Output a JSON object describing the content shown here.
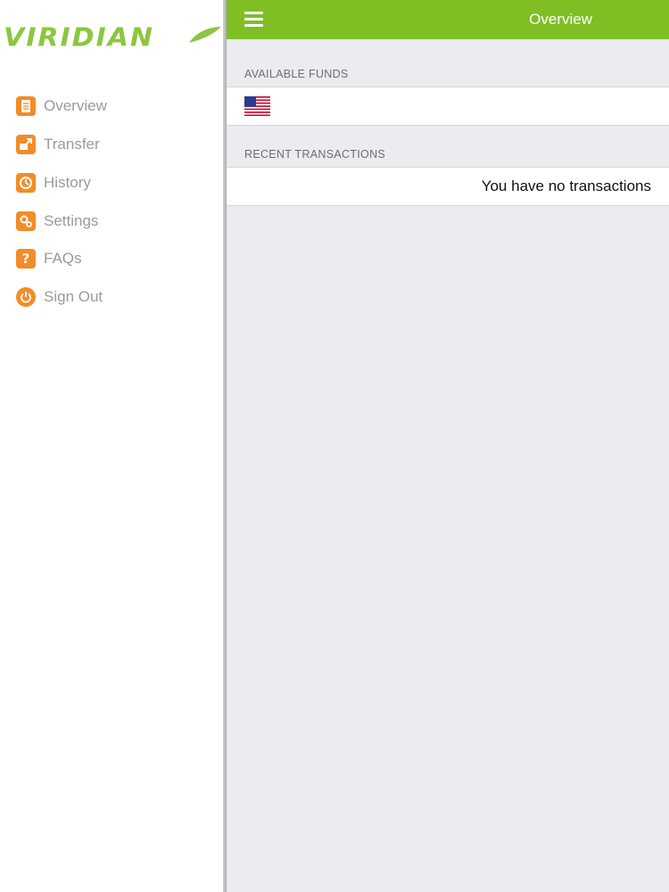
{
  "brand": {
    "logo_text": "VIRIDIAN",
    "accent_color": "#7fbf24",
    "icon_color": "#f28c28"
  },
  "sidebar": {
    "items": [
      {
        "label": "Overview",
        "icon": "document-icon"
      },
      {
        "label": "Transfer",
        "icon": "transfer-icon"
      },
      {
        "label": "History",
        "icon": "history-icon"
      },
      {
        "label": "Settings",
        "icon": "gear-icon"
      },
      {
        "label": "FAQs",
        "icon": "question-icon"
      },
      {
        "label": "Sign Out",
        "icon": "power-icon"
      }
    ]
  },
  "header": {
    "title": "Overview",
    "menu_icon": "hamburger-menu-icon"
  },
  "available_funds": {
    "label": "AVAILABLE FUNDS",
    "currency_icon": "us-flag-icon"
  },
  "recent_transactions": {
    "label": "RECENT TRANSACTIONS",
    "empty_message": "You have no transactions"
  }
}
